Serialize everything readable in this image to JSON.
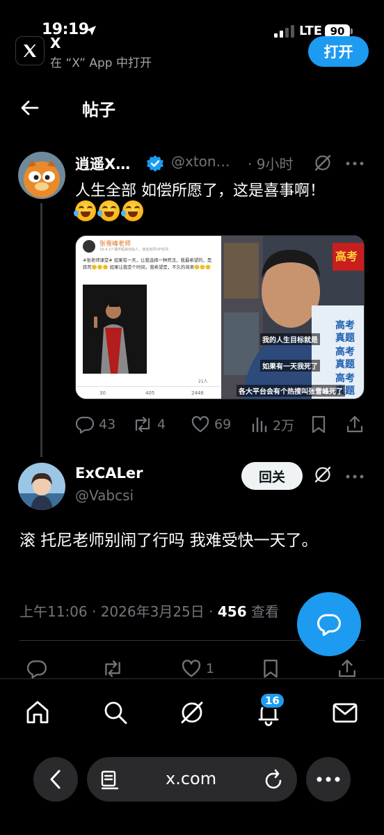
{
  "status_bar": {
    "time": "19:19",
    "network": "LTE",
    "battery": "90"
  },
  "app_banner": {
    "title": "X",
    "subtitle": "在 “X” App 中打开",
    "open_label": "打开"
  },
  "header": {
    "title": "帖子"
  },
  "post1": {
    "name": "逍遥X…",
    "handle": "@xton…",
    "time": "· 9小时",
    "text": "人生全部 如偿所愿了，这是喜事啊！",
    "media_left": {
      "author": "张雪峰老师",
      "meta": "18-4-27  睡学超来创始人，谋途考研VIP名师",
      "body": "#张老师课堂# 如果有一天，让我选择一种死法，我最希望的，是猝死🙂🙂🙂 如果让我定个时间，我希望是，不久的将来🙂🙂🙂",
      "stats": [
        "30",
        "405",
        "2446"
      ],
      "count": "21人"
    },
    "media_right": {
      "sign": "高考",
      "captions": [
        "我的人生目标就是",
        "如果有一天我死了",
        "各大平台会有个热搜叫张雪峰死了"
      ],
      "books": [
        "高考真题",
        "高考真题",
        "高考真题"
      ]
    },
    "actions": {
      "replies": "43",
      "reposts": "4",
      "likes": "69",
      "views": "2万"
    }
  },
  "post2": {
    "name": "ExCALer",
    "handle": "@Vabcsi",
    "follow_label": "回关",
    "text": "滚 托尼老师别闹了行吗 我难受快一天了。",
    "timestamp": "上午11:06 · 2026年3月25日 · ",
    "views": "456",
    "views_suffix": " 查看",
    "actions": {
      "likes": "1"
    }
  },
  "bottom_nav": {
    "notifications_badge": "16"
  },
  "browser": {
    "url": "x.com"
  },
  "colors": {
    "accent": "#1d9bf0",
    "background": "#000000",
    "muted": "#71767b"
  }
}
